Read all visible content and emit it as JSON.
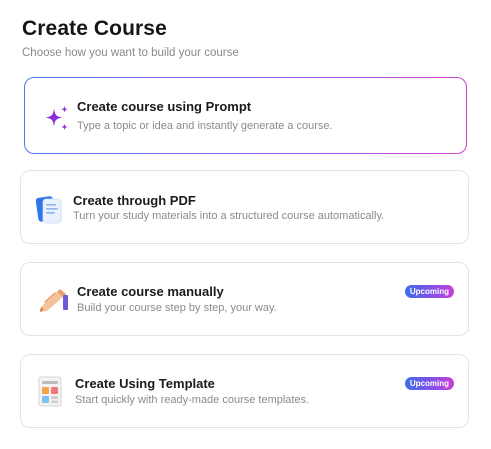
{
  "header": {
    "title": "Create Course",
    "subtitle": "Choose how you want to build your course"
  },
  "options": [
    {
      "title": "Create course using Prompt",
      "description": "Type a topic or idea and instantly generate a course.",
      "icon": "sparkles-icon",
      "selected": true
    },
    {
      "title": "Create through PDF",
      "description": "Turn your study materials into a structured course automatically.",
      "icon": "pdf-document-icon"
    },
    {
      "title": "Create course manually",
      "description": "Build your course step by step, your way.",
      "icon": "pencil-icon",
      "badge": "Upcoming"
    },
    {
      "title": "Create Using Template",
      "description": "Start quickly with ready-made course templates.",
      "icon": "template-icon",
      "badge": "Upcoming"
    }
  ],
  "colors": {
    "accent_gradient_start": "#4a78e6",
    "accent_gradient_end": "#d23ccf",
    "sparkle": "#8b2fd9",
    "badge_start": "#3b6ee9",
    "badge_end": "#c93fd6"
  }
}
